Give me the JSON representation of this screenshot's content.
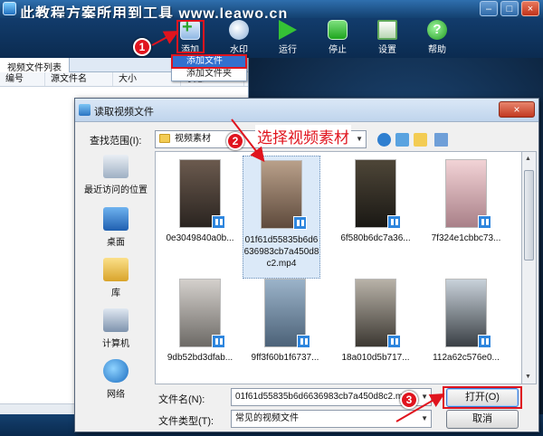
{
  "app": {
    "title": "此教程方案所用到工具  www.leawo.cn",
    "window_buttons": [
      "–",
      "□",
      "×"
    ]
  },
  "toolbar": {
    "add": "添加",
    "watermark": "水印",
    "run": "运行",
    "stop": "停止",
    "settings": "设置",
    "help": "帮助",
    "help_glyph": "?"
  },
  "add_menu": {
    "items": [
      "添加文件",
      "添加文件夹"
    ]
  },
  "file_list": {
    "tab": "视频文件列表",
    "columns": [
      "编号",
      "源文件名",
      "大小",
      "状态"
    ]
  },
  "dialog": {
    "title": "读取视频文件",
    "close_glyph": "×",
    "lookin_label": "查找范围(I):",
    "lookin_value": "视频素材",
    "places": [
      "最近访问的位置",
      "桌面",
      "库",
      "计算机",
      "网络"
    ],
    "files": [
      "0e3049840a0b...",
      "01f61d55835b6d6636983cb7a450d8c2.mp4",
      "6f580b6dc7a36...",
      "7f324e1cbbc73...",
      "9db52bd3dfab...",
      "9ff3f60b1f6737...",
      "18a010d5b717...",
      "112a62c576e0..."
    ],
    "filename_label": "文件名(N):",
    "filename_value": "01f61d55835b6d6636983cb7a450d8c2.mp4",
    "filetype_label": "文件类型(T):",
    "filetype_value": "常见的视频文件",
    "open_button": "打开(O)",
    "cancel_button": "取消"
  },
  "annotations": {
    "step1": "1",
    "step2": "2",
    "step3": "3",
    "select_material": "选择视频素材"
  },
  "colors": {
    "accent_red": "#e0141e",
    "selection_blue": "#3270cf",
    "toolbar_bg": "#123c6c"
  }
}
